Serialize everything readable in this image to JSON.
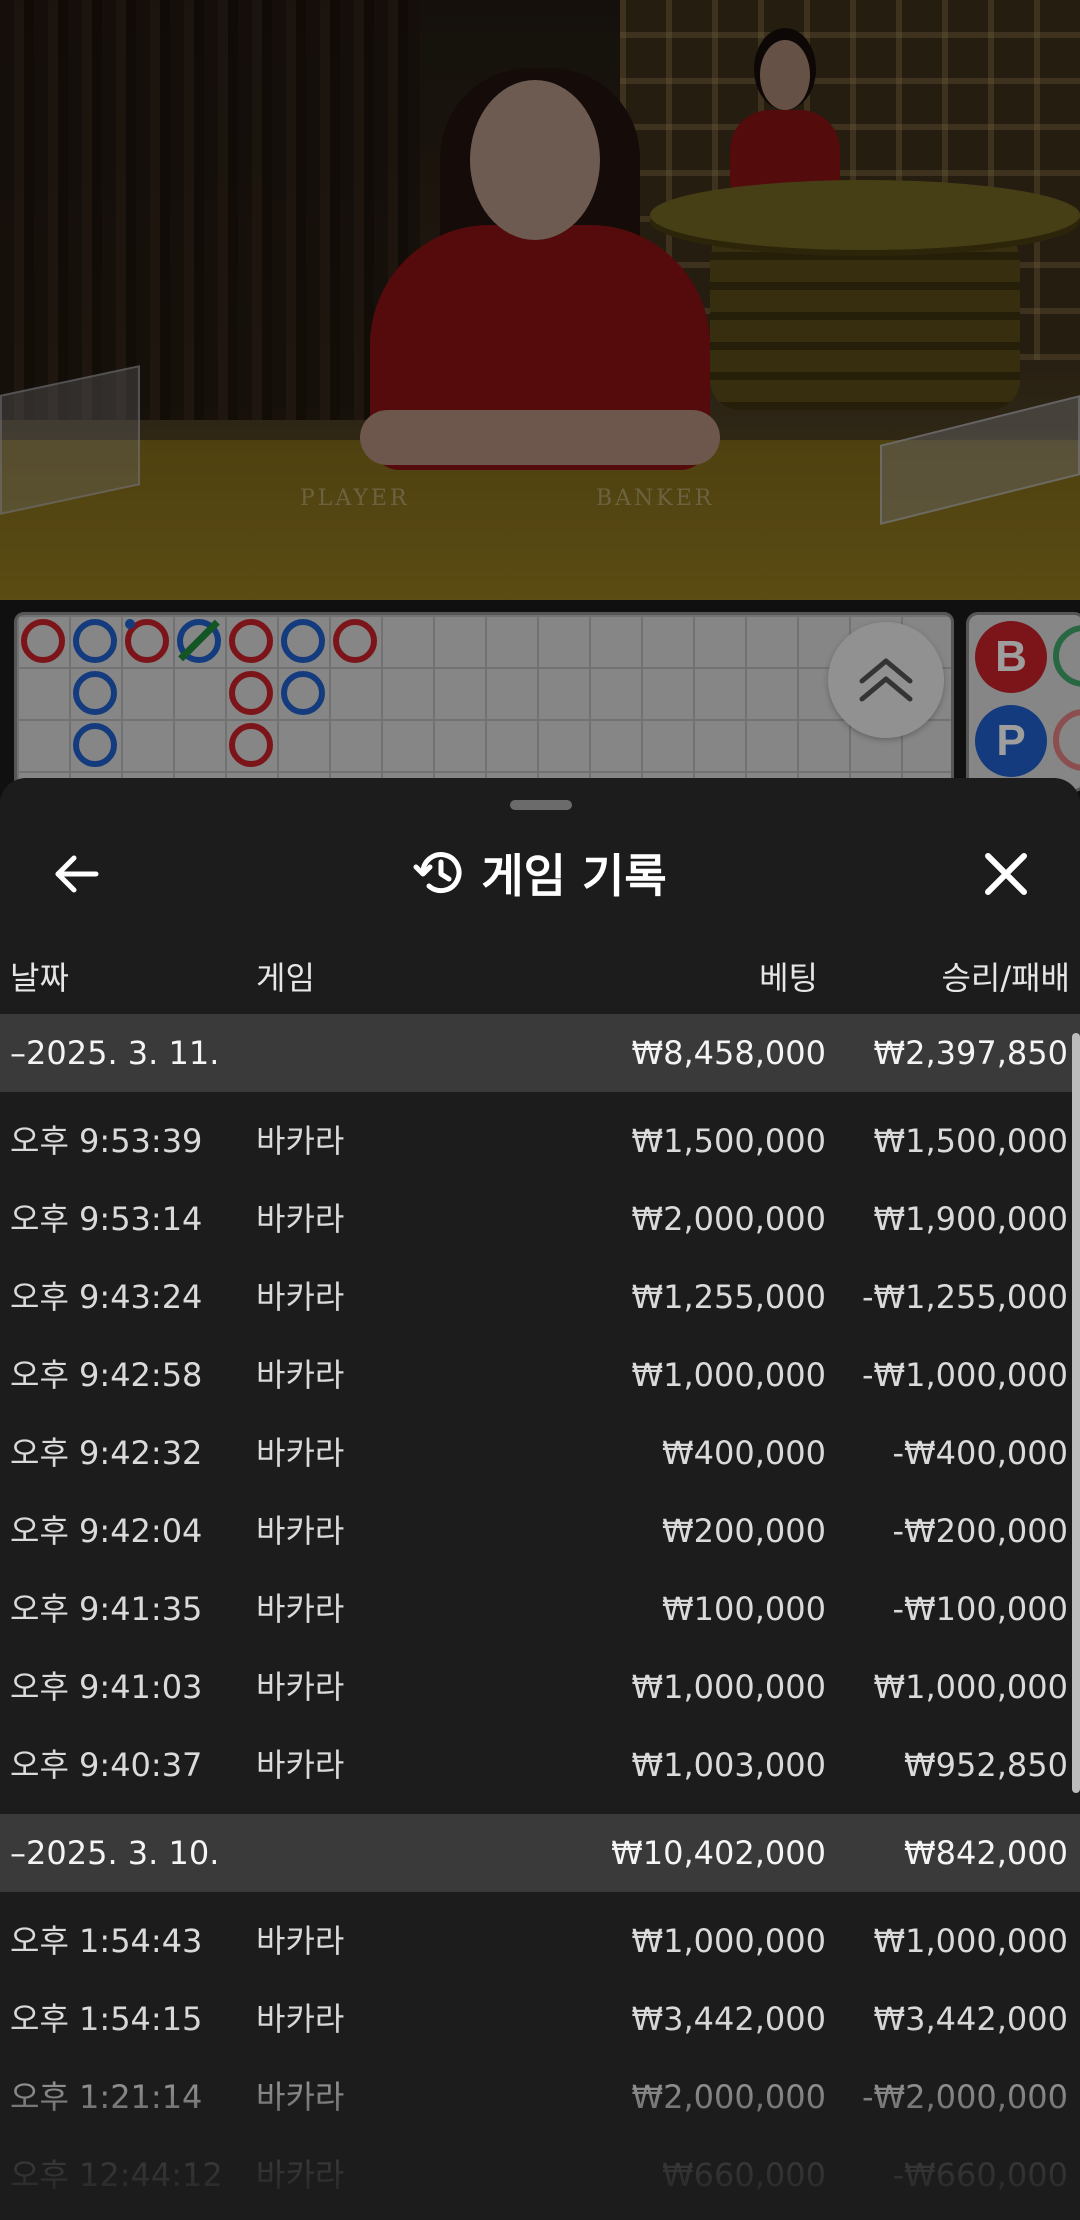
{
  "video": {
    "table_labels": [
      "PLAYER",
      "BANKER"
    ]
  },
  "roadmap": {
    "side_badges": [
      "B",
      "P"
    ],
    "colors": {
      "banker": "#c8232b",
      "player": "#1f5fcc",
      "tie": "#1f8a3b"
    }
  },
  "sheet": {
    "title": "게임 기록",
    "icons": {
      "back": "arrow-left-icon",
      "history": "history-icon",
      "close": "close-icon",
      "expand": "chevron-up-double-icon"
    },
    "columns": {
      "date": "날짜",
      "game": "게임",
      "bet": "베팅",
      "result": "승리/패배"
    },
    "groups": [
      {
        "date": "–2025. 3. 11.",
        "bet_total": "₩8,458,000",
        "result_total": "₩2,397,850",
        "rows": [
          {
            "time": "오후 9:53:39",
            "game": "바카라",
            "bet": "₩1,500,000",
            "result": "₩1,500,000"
          },
          {
            "time": "오후 9:53:14",
            "game": "바카라",
            "bet": "₩2,000,000",
            "result": "₩1,900,000"
          },
          {
            "time": "오후 9:43:24",
            "game": "바카라",
            "bet": "₩1,255,000",
            "result": "-₩1,255,000"
          },
          {
            "time": "오후 9:42:58",
            "game": "바카라",
            "bet": "₩1,000,000",
            "result": "-₩1,000,000"
          },
          {
            "time": "오후 9:42:32",
            "game": "바카라",
            "bet": "₩400,000",
            "result": "-₩400,000"
          },
          {
            "time": "오후 9:42:04",
            "game": "바카라",
            "bet": "₩200,000",
            "result": "-₩200,000"
          },
          {
            "time": "오후 9:41:35",
            "game": "바카라",
            "bet": "₩100,000",
            "result": "-₩100,000"
          },
          {
            "time": "오후 9:41:03",
            "game": "바카라",
            "bet": "₩1,000,000",
            "result": "₩1,000,000"
          },
          {
            "time": "오후 9:40:37",
            "game": "바카라",
            "bet": "₩1,003,000",
            "result": "₩952,850"
          }
        ]
      },
      {
        "date": "–2025. 3. 10.",
        "bet_total": "₩10,402,000",
        "result_total": "₩842,000",
        "rows": [
          {
            "time": "오후 1:54:43",
            "game": "바카라",
            "bet": "₩1,000,000",
            "result": "₩1,000,000"
          },
          {
            "time": "오후 1:54:15",
            "game": "바카라",
            "bet": "₩3,442,000",
            "result": "₩3,442,000"
          },
          {
            "time": "오후 1:21:14",
            "game": "바카라",
            "bet": "₩2,000,000",
            "result": "-₩2,000,000"
          },
          {
            "time": "오후 12:44:12",
            "game": "바카라",
            "bet": "₩660,000",
            "result": "-₩660,000"
          }
        ]
      }
    ]
  }
}
